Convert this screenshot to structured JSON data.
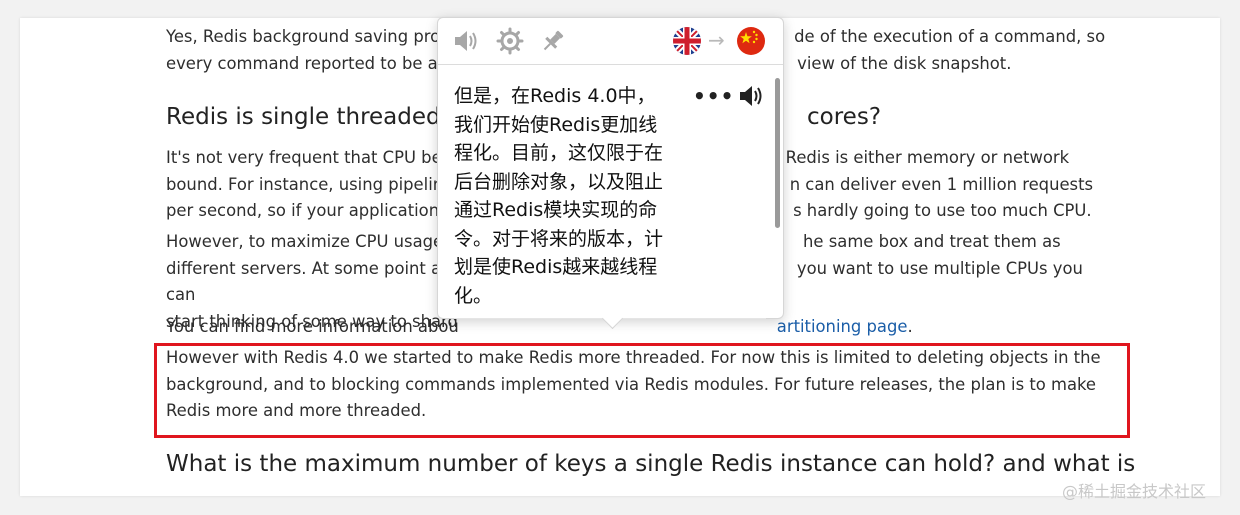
{
  "article": {
    "p1_line1": "Yes, Redis background saving proc",
    "p1_line1_end": "de of the execution of a command, so",
    "p1_line2": "every command reported to be ato",
    "p1_line2_end": "view of the disk snapshot.",
    "h1_start": "Redis is single threaded. I",
    "h1_end": "cores?",
    "p2_line1": "It's not very frequent that CPU bec",
    "p2_line1_end": "Redis is either memory or network",
    "p2_line2": "bound. For instance, using pipelini",
    "p2_line2_end": "n can deliver even 1 million requests",
    "p2_line3": "per second, so if your application r",
    "p2_line3_end": "s hardly going to use too much CPU.",
    "p3_line1": "However, to maximize CPU usage y",
    "p3_line1_end": "he same box and treat them as",
    "p3_line2": "different servers. At some point a s",
    "p3_line2_end": "you want to use multiple CPUs you can",
    "p3_line3": "start thinking of some way to shard",
    "p4_text": "You can find more information abou",
    "p4_link": "artitioning page",
    "p4_end": ".",
    "highlight_line1": "However with Redis 4.0 we started to make Redis more threaded. For now this is limited to deleting objects in the",
    "highlight_line2": "background, and to blocking commands implemented via Redis modules. For future releases, the plan is to make",
    "highlight_line3": "Redis more and more threaded.",
    "h2_line1": "What is the maximum number of keys a single Redis instance can hold? and what is"
  },
  "popup": {
    "arrow": "→",
    "more": "•••",
    "translation_lines": [
      "但是，在Redis 4.0中，",
      "我们开始使Redis更加线",
      "程化。目前，这仅限于在",
      "后台删除对象，以及阻止",
      "通过Redis模块实现的命",
      "令。对于将来的版本，计",
      "划是使Redis越来越线程",
      "化。"
    ]
  },
  "watermark": "@稀土掘金技术社区",
  "colors": {
    "highlight_border": "#e0161e",
    "link": "#1b5ea8"
  },
  "icons": [
    "speaker-icon",
    "settings-gear-icon",
    "pin-icon",
    "uk-flag-icon",
    "china-flag-icon",
    "more-options-icon"
  ]
}
